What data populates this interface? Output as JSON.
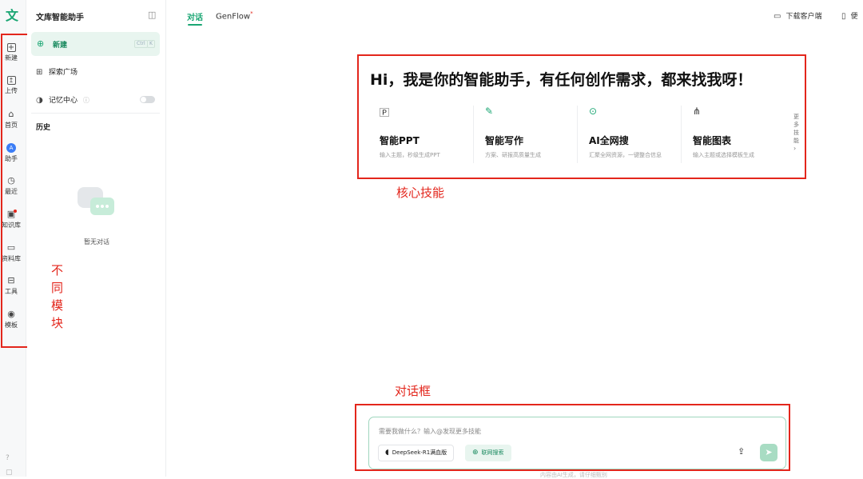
{
  "rail": {
    "logo": "文",
    "items": [
      {
        "label": "新建",
        "icon": "plus-square-icon"
      },
      {
        "label": "上传",
        "icon": "upload-icon"
      },
      {
        "label": "首页",
        "icon": "home-icon"
      },
      {
        "label": "助手",
        "icon": "assistant-icon",
        "active": true
      },
      {
        "label": "最近",
        "icon": "clock-icon"
      },
      {
        "label": "知识库",
        "icon": "knowledge-base-icon",
        "badge": true
      },
      {
        "label": "资料库",
        "icon": "folder-icon"
      },
      {
        "label": "工具",
        "icon": "toolbox-icon"
      },
      {
        "label": "模板",
        "icon": "palette-icon"
      }
    ]
  },
  "sidebar": {
    "title": "文库智能助手",
    "new_label": "新建",
    "new_shortcut": [
      "Ctrl",
      "K"
    ],
    "explore_label": "探索广场",
    "memory_label": "记忆中心",
    "history_label": "历史",
    "empty_label": "暂无对话"
  },
  "tabs": [
    {
      "label": "对话",
      "active": true
    },
    {
      "label": "GenFlow",
      "badge": "*"
    }
  ],
  "topbar": {
    "download_label": "下载客户端",
    "cut_label": "便"
  },
  "hero": {
    "headline": "Hi，我是你的智能助手，有任何创作需求，都来找我呀！",
    "cards": [
      {
        "name": "智能PPT",
        "desc": "输入主题，秒级生成PPT",
        "icon": "ppt-icon"
      },
      {
        "name": "智能写作",
        "desc": "方案、研报高质量生成",
        "icon": "pen-icon"
      },
      {
        "name": "AI全网搜",
        "desc": "汇聚全网资源，一键整合信息",
        "icon": "search-icon"
      },
      {
        "name": "智能图表",
        "desc": "输入主题或选择模板生成",
        "icon": "diagram-icon"
      }
    ],
    "more_label": "更多技能"
  },
  "annotations": {
    "core_skills": "核心技能",
    "modules": "不同模块",
    "chat_box": "对话框"
  },
  "chat": {
    "placeholder": "需要我做什么？输入@发现更多技能",
    "model_chip": "DeepSeek-R1满血版",
    "web_search_chip": "联网搜索",
    "footer_text": "内容由AI生成，请仔细甄别"
  },
  "colors": {
    "accent": "#1aa673",
    "annotation_red": "#e3261c",
    "active_blue": "#3b7df6"
  }
}
